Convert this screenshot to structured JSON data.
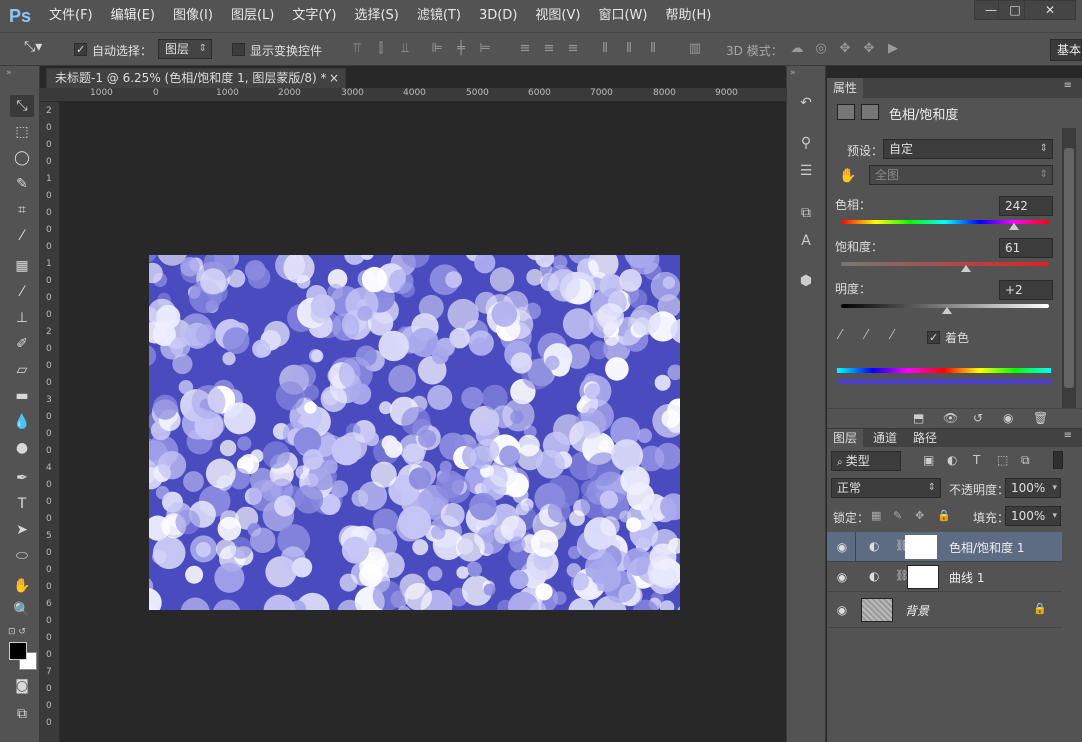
{
  "menubar": {
    "logo": "Ps",
    "items": [
      "文件(F)",
      "编辑(E)",
      "图像(I)",
      "图层(L)",
      "文字(Y)",
      "选择(S)",
      "滤镜(T)",
      "3D(D)",
      "视图(V)",
      "窗口(W)",
      "帮助(H)"
    ],
    "win_min": "—",
    "win_max": "□",
    "win_close": "✕"
  },
  "options": {
    "auto_select_label": "自动选择：",
    "auto_select_value": "图层",
    "show_transform_label": "显示变换控件",
    "mode_3d_label": "3D 模式：",
    "basic_label": "基本"
  },
  "document": {
    "tab_title": "未标题-1 @ 6.25% (色相/饱和度 1, 图层蒙版/8) *",
    "tab_close": "×",
    "ruler_ticks": [
      "1000",
      "0",
      "1000",
      "2000",
      "3000",
      "4000",
      "5000",
      "6000",
      "7000",
      "8000",
      "9000"
    ],
    "v_ruler_digits": [
      "2",
      "0",
      "0",
      "0",
      "1",
      "0",
      "0",
      "0",
      "0",
      "1",
      "0",
      "0",
      "0",
      "2",
      "0",
      "0",
      "0",
      "3",
      "0",
      "0",
      "0",
      "4",
      "0",
      "0",
      "0",
      "5",
      "0",
      "0",
      "0",
      "6",
      "0",
      "0",
      "0",
      "7",
      "0",
      "0",
      "0"
    ]
  },
  "properties": {
    "tab": "属性",
    "title": "色相/饱和度",
    "preset_label": "预设：",
    "preset_value": "自定",
    "channel_value": "全图",
    "hue_label": "色相：",
    "hue_value": "242",
    "saturation_label": "饱和度：",
    "saturation_value": "61",
    "lightness_label": "明度：",
    "lightness_value": "+2",
    "colorize_label": "着色",
    "hue_fraction": 0.83,
    "saturation_fraction": 0.6,
    "lightness_fraction": 0.51
  },
  "layers": {
    "tabs": [
      "图层",
      "通道",
      "路径"
    ],
    "filter_value": "类型",
    "blend_mode": "正常",
    "opacity_label": "不透明度：",
    "opacity_value": "100%",
    "lock_label": "锁定：",
    "fill_label": "填充：",
    "fill_value": "100%",
    "rows": [
      {
        "name": "色相/饱和度 1"
      },
      {
        "name": "曲线 1"
      },
      {
        "name": "背景"
      }
    ]
  },
  "colors": {
    "accent_selected_layer": "#5d6b83",
    "canvas_base": "#5252c4"
  }
}
